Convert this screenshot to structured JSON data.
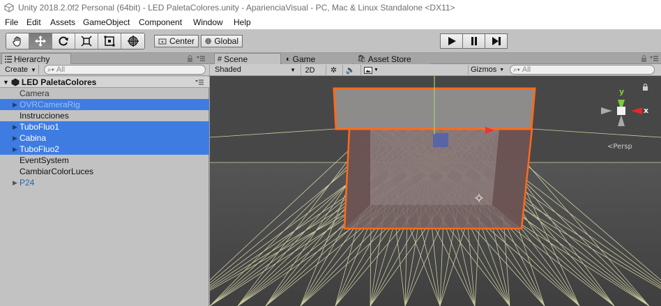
{
  "window": {
    "title": "Unity 2018.2.0f2 Personal (64bit) - LED PaletaColores.unity - AparienciaVisual - PC, Mac & Linux Standalone <DX11>"
  },
  "menu": [
    "File",
    "Edit",
    "Assets",
    "GameObject",
    "Component",
    "Window",
    "Help"
  ],
  "toolbar": {
    "tools": [
      "hand-icon",
      "move-icon",
      "rotate-icon",
      "scale-icon",
      "rect-icon",
      "transform-icon"
    ],
    "active_tool": 1,
    "pivot_label": "Center",
    "rotation_label": "Global",
    "play_controls": [
      "play-icon",
      "pause-icon",
      "step-icon"
    ]
  },
  "hierarchy": {
    "tab_label": "Hierarchy",
    "create_label": "Create",
    "search_placeholder": "All",
    "scene_name": "LED PaletaColores",
    "items": [
      {
        "label": "Camera",
        "expandable": false,
        "selected": false,
        "color": "#333333"
      },
      {
        "label": "OVRCameraRig",
        "expandable": true,
        "selected": true,
        "color": "#9fbef0"
      },
      {
        "label": "Instrucciones",
        "expandable": false,
        "selected": false,
        "color": "#111111"
      },
      {
        "label": "TuboFluo1",
        "expandable": true,
        "selected": true,
        "color": "#ffffff"
      },
      {
        "label": "Cabina",
        "expandable": true,
        "selected": true,
        "color": "#ffffff"
      },
      {
        "label": "TuboFluo2",
        "expandable": true,
        "selected": true,
        "color": "#ffffff"
      },
      {
        "label": "EventSystem",
        "expandable": false,
        "selected": false,
        "color": "#111111"
      },
      {
        "label": "CambiarColorLuces",
        "expandable": false,
        "selected": false,
        "color": "#111111"
      },
      {
        "label": "P24",
        "expandable": true,
        "selected": false,
        "color": "#2a5fb3"
      }
    ]
  },
  "scene_view": {
    "tabs": [
      {
        "label": "Scene",
        "active": true
      },
      {
        "label": "Game",
        "active": false
      },
      {
        "label": "Asset Store",
        "active": false
      }
    ],
    "shading_mode": "Shaded",
    "mode_2d": "2D",
    "gizmos_label": "Gizmos",
    "search_placeholder": "All",
    "persp_label": "Persp",
    "axis_labels": {
      "y": "y",
      "x": "x"
    },
    "colors": {
      "selection_outline": "#ff6a1a",
      "wire": "#e8e6b2",
      "background": "#474747",
      "selection_blue": "#3e7ce2"
    }
  }
}
